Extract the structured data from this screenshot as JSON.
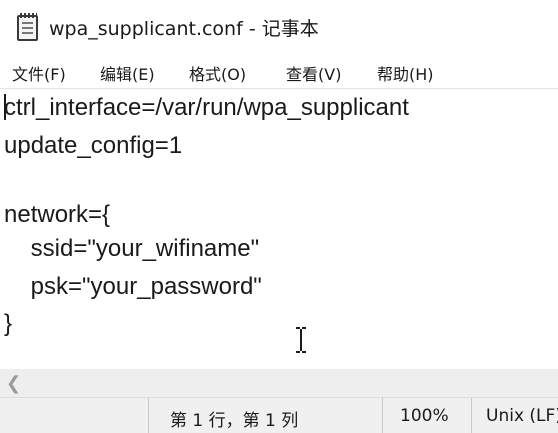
{
  "window": {
    "title": "wpa_supplicant.conf - 记事本",
    "app_icon": "notepad-icon"
  },
  "menu": {
    "items": [
      {
        "label": "文件(F)"
      },
      {
        "label": "编辑(E)"
      },
      {
        "label": "格式(O)"
      },
      {
        "label": "查看(V)"
      },
      {
        "label": "帮助(H)"
      }
    ]
  },
  "editor": {
    "lines": [
      "ctrl_interface=/var/run/wpa_supplicant",
      "update_config=1",
      "",
      "network={",
      "    ssid=\"your_wifiname\"",
      "    psk=\"your_password\"",
      "}"
    ]
  },
  "statusbar": {
    "position": "第 1 行，第 1 列",
    "zoom": "100%",
    "line_ending": "Unix (LF)"
  },
  "icons": {
    "scroll_left": "chevron-left-icon",
    "cursor": "i-beam-cursor-icon"
  }
}
